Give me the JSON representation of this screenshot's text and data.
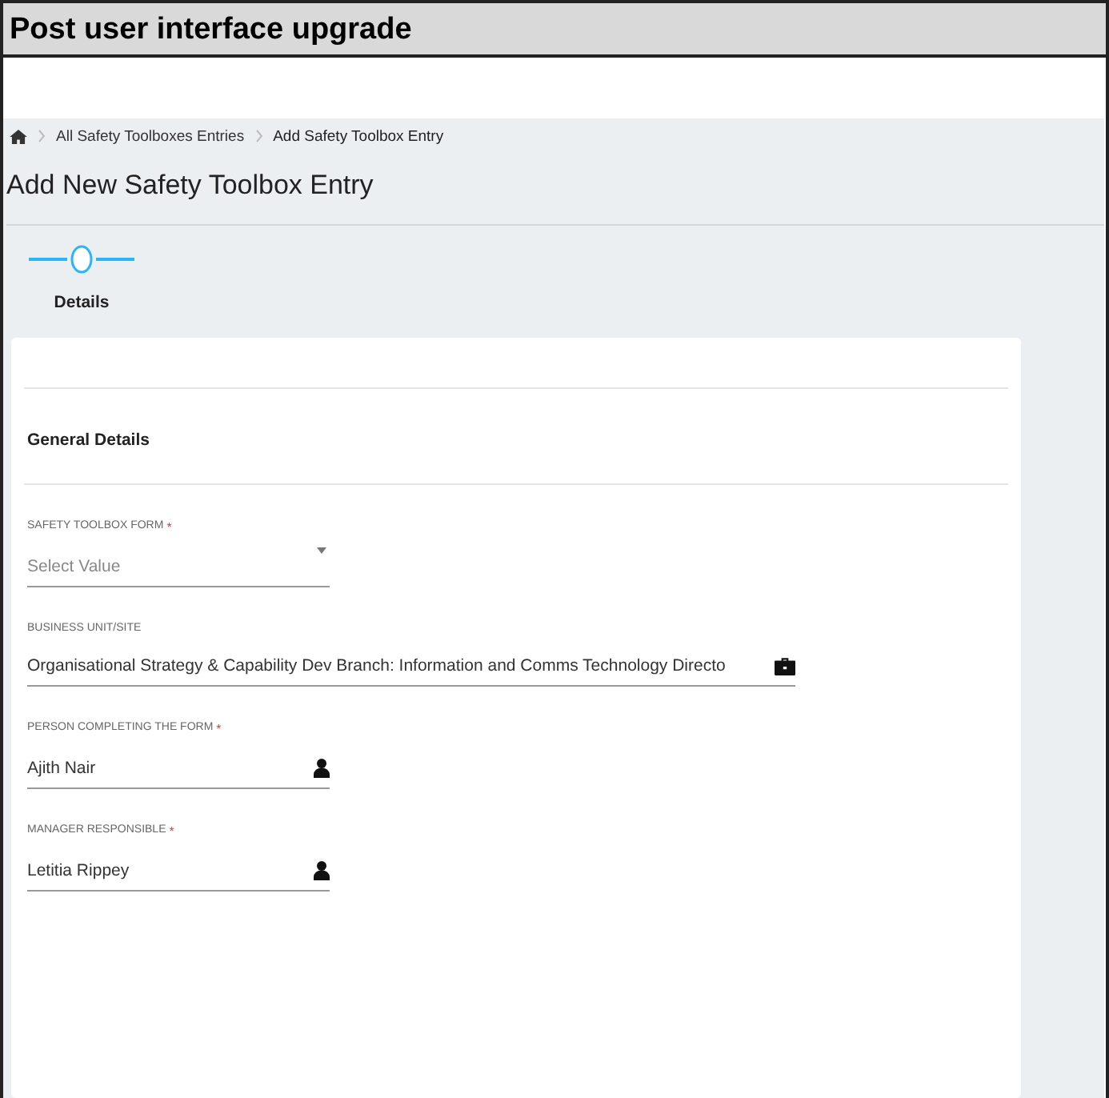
{
  "banner": {
    "title": "Post user interface upgrade"
  },
  "breadcrumb": [
    "All Safety Toolboxes Entries",
    "Add Safety Toolbox Entry"
  ],
  "page_title": "Add New Safety Toolbox Entry",
  "steps": [
    {
      "label": "Details",
      "selected": true
    }
  ],
  "section_title": "General Details",
  "fields": [
    {
      "kind": "select",
      "label": "SAFETY TOOLBOX FORM",
      "required_mark": "*",
      "placeholder": "Select Value"
    },
    {
      "kind": "site",
      "label": "BUSINESS UNIT/SITE",
      "value": "Organisational Strategy & Capability Dev Branch: Information and Comms Technology Directo"
    },
    {
      "kind": "person",
      "label": "PERSON COMPLETING THE FORM",
      "required_mark": "*",
      "value": "Ajith Nair"
    },
    {
      "kind": "person",
      "label": "MANAGER RESPONSIBLE",
      "required_mark": "*",
      "value": "Letitia Rippey"
    }
  ]
}
